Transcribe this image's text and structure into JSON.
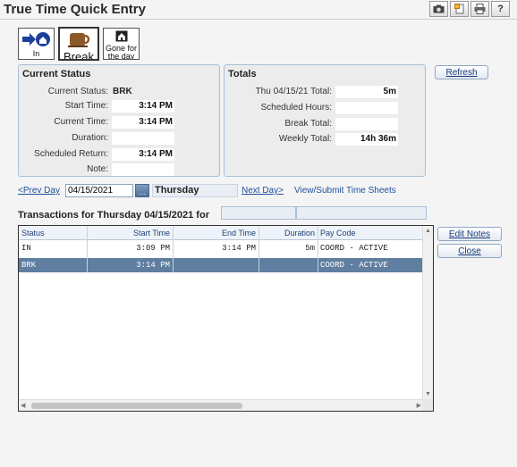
{
  "window": {
    "title": "True Time Quick Entry"
  },
  "toolbar": {
    "icons": [
      "camera-icon",
      "notes-icon",
      "print-icon",
      "help-icon"
    ],
    "help_label": "?"
  },
  "punch_buttons": [
    {
      "label": "In",
      "icon": "in-arrow-icon"
    },
    {
      "label": "Break",
      "icon": "coffee-icon"
    },
    {
      "label": "Gone for the day",
      "icon": "house-icon"
    }
  ],
  "current_status": {
    "heading": "Current Status",
    "fields": [
      {
        "label": "Current Status:",
        "value": "BRK"
      },
      {
        "label": "Start Time:",
        "value": "3:14 PM"
      },
      {
        "label": "Current Time:",
        "value": "3:14 PM"
      },
      {
        "label": "Duration:",
        "value": ""
      },
      {
        "label": "Scheduled Return:",
        "value": "3:14 PM"
      },
      {
        "label": "Note:",
        "value": ""
      }
    ]
  },
  "totals": {
    "heading": "Totals",
    "fields": [
      {
        "label": "Thu 04/15/21 Total:",
        "value": "5m"
      },
      {
        "label": "Scheduled Hours:",
        "value": ""
      },
      {
        "label": "Break Total:",
        "value": ""
      },
      {
        "label": "Weekly Total:",
        "value": "14h 36m"
      }
    ]
  },
  "buttons": {
    "refresh": "Refresh",
    "edit_notes": "Edit Notes",
    "close": "Close"
  },
  "nav": {
    "prev_day": "<Prev Day",
    "date_value": "04/15/2021",
    "day_name": "Thursday",
    "next_day": "Next Day>",
    "view_submit": "View/Submit Time Sheets"
  },
  "transactions": {
    "heading": "Transactions for Thursday 04/15/2021 for",
    "columns": [
      "Status",
      "Start Time",
      "End Time",
      "Duration",
      "Pay Code"
    ],
    "rows": [
      {
        "status": "IN",
        "start": "3:09 PM",
        "end": "3:14 PM",
        "duration": "5m",
        "pay_code": "COORD - ACTIVE",
        "selected": false
      },
      {
        "status": "BRK",
        "start": "3:14 PM",
        "end": "",
        "duration": "",
        "pay_code": "COORD - ACTIVE",
        "selected": true
      }
    ]
  },
  "colors": {
    "accent": "#1f4f9e",
    "selected_row": "#5f7ea0",
    "panel_border": "#a8bfd6"
  }
}
